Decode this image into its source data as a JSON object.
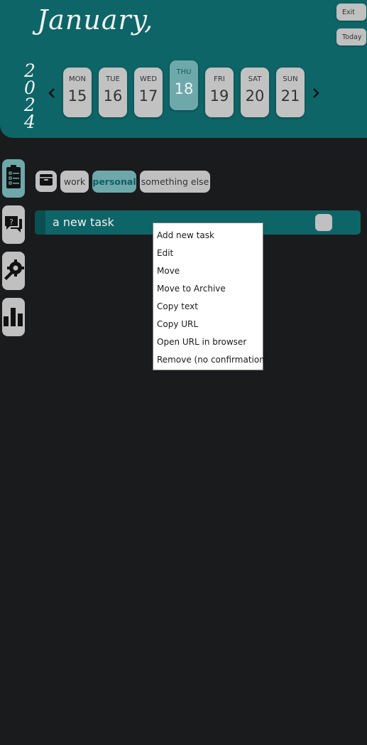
{
  "header": {
    "month": "January,",
    "year_digits": [
      "2",
      "0",
      "2",
      "4"
    ],
    "exit_label": "Exit",
    "today_label": "Today",
    "prev_arrow": "‹",
    "next_arrow": "›"
  },
  "week": [
    {
      "name": "MON",
      "date": "15"
    },
    {
      "name": "TUE",
      "date": "16"
    },
    {
      "name": "WED",
      "date": "17"
    },
    {
      "name": "THU",
      "date": "18"
    },
    {
      "name": "FRI",
      "date": "19"
    },
    {
      "name": "SAT",
      "date": "20"
    },
    {
      "name": "SUN",
      "date": "21"
    }
  ],
  "selected_day": "THU",
  "sidebar": {
    "items": [
      {
        "icon": "clipboard-checklist-icon"
      },
      {
        "icon": "help-chat-icon"
      },
      {
        "icon": "settings-wrench-gear-icon"
      },
      {
        "icon": "bar-chart-icon"
      }
    ]
  },
  "toolbar": {
    "archive_icon": "archive-box-icon",
    "tags": [
      "work",
      "personal",
      "something else"
    ],
    "active_tag": "personal"
  },
  "tasks": [
    {
      "title": "a new task"
    }
  ],
  "context_menu": {
    "items": [
      "Add new task",
      "Edit",
      "Move",
      "Move to Archive",
      "Copy text",
      "Copy URL",
      "Open URL in browser",
      "Remove (no confirmation)"
    ]
  },
  "colors": {
    "background": "#1a1b1d",
    "header_teal": "#0e6567",
    "active_teal": "#6fa8ab",
    "button_gray": "#c0c0c0"
  }
}
